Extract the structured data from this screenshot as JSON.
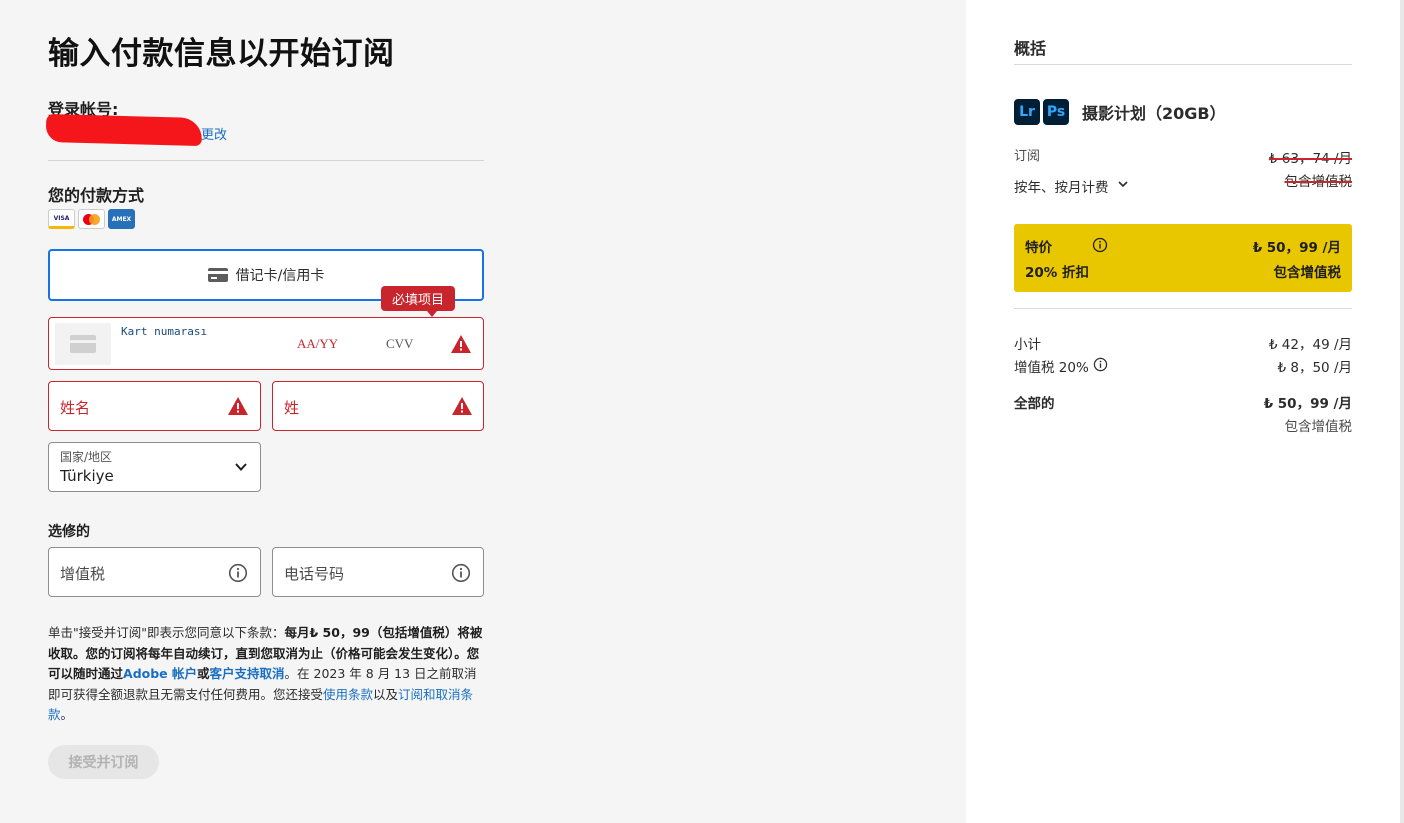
{
  "page": {
    "title": "输入付款信息以开始订阅",
    "account_label": "登录帐号:",
    "change_link": "更改",
    "payment_method_label": "您的付款方式",
    "card_brands": [
      "VISA",
      "mastercard",
      "AMEX"
    ],
    "credit_card_button": "借记卡/信用卡",
    "required_tip": "必填项目",
    "card_number_placeholder": "Kart numarası",
    "expiry_placeholder": "AA/YY",
    "cvv_placeholder": "CVV",
    "first_name_label": "姓名",
    "last_name_label": "姓",
    "country_label": "国家/地区",
    "country_value": "Türkiye",
    "optional_label": "选修的",
    "vat_label": "增值税",
    "phone_label": "电话号码",
    "terms": {
      "p1": "单击\"接受并订阅\"即表示您同意以下条款：",
      "p2": "每月₺ 50，99（包括增值税）将被收取。您的订阅将每年自动续订，直到您取消为止（价格可能会发生变化）。您可以随时通过",
      "link_account": "Adobe 帐户",
      "p3": "或",
      "link_support": "客户支持取消",
      "p4": "。在 2023 年 8 月 13 日之前取消即可获得全额退款且无需支付任何费用。您还接受",
      "link_terms": "使用条款",
      "p5": "以及",
      "link_cancel": "订阅和取消条款",
      "p6": "。"
    },
    "submit_label": "接受并订阅"
  },
  "summary": {
    "title": "概括",
    "product_icons": [
      "Lr",
      "Ps"
    ],
    "product_name": "摄影计划（20GB）",
    "subscription_label": "订阅",
    "billing_option": "按年、按月计费",
    "original_price": "₺ 63，74 /月",
    "original_vat": "包含增值税",
    "promo_label": "特价",
    "promo_price": "₺ 50，99 /月",
    "promo_discount": "20% 折扣",
    "promo_vat": "包含增值税",
    "subtotal_label": "小计",
    "subtotal_value": "₺ 42，49 /月",
    "vat_label": "增值税 20%",
    "vat_value": "₺ 8，50 /月",
    "total_label": "全部的",
    "total_value": "₺ 50，99 /月",
    "total_vat": "包含增值税"
  },
  "colors": {
    "accent_blue": "#1473e6",
    "error_red": "#c9252d",
    "promo_yellow": "#e8c600"
  }
}
